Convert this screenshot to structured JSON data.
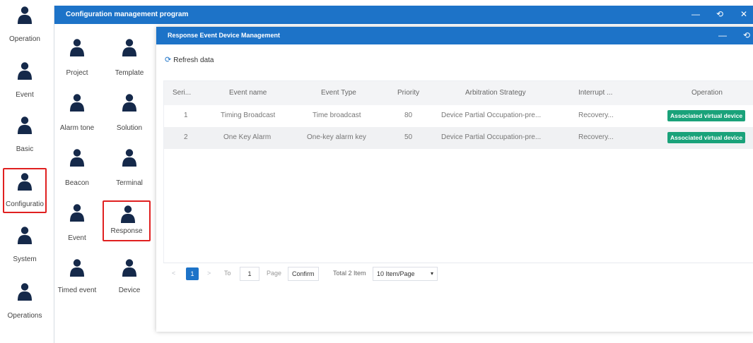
{
  "colors": {
    "titlebar": "#1d73c8",
    "accent": "#1aa27a",
    "selected_border": "#e02020",
    "person_icon": "#15294a"
  },
  "sidebar": {
    "items": [
      {
        "label": "Operation",
        "icon": "user-icon"
      },
      {
        "label": "Event",
        "icon": "user-icon"
      },
      {
        "label": "Basic",
        "icon": "user-icon"
      },
      {
        "label": "Configuratio",
        "icon": "user-icon",
        "selected": true
      },
      {
        "label": "System",
        "icon": "user-icon"
      },
      {
        "label": "Operations",
        "icon": "user-icon"
      }
    ]
  },
  "program": {
    "title": "Configuration management program",
    "controls": {
      "minimize": "—",
      "restore": "⟲",
      "close": "✕"
    },
    "grid": [
      {
        "label": "Project"
      },
      {
        "label": "Template"
      },
      {
        "label": "Alarm tone"
      },
      {
        "label": "Solution"
      },
      {
        "label": "Beacon"
      },
      {
        "label": "Terminal"
      },
      {
        "label": "Event"
      },
      {
        "label": "Response",
        "selected": true
      },
      {
        "label": "Timed event"
      },
      {
        "label": "Device"
      }
    ]
  },
  "dialog": {
    "title": "Response Event Device Management",
    "controls": {
      "minimize": "—",
      "restore": "⟲"
    },
    "refresh_label": "Refresh data",
    "table": {
      "headers": [
        "Seri...",
        "Event name",
        "Event Type",
        "Priority",
        "Arbitration Strategy",
        "Interrupt ...",
        "Operation"
      ],
      "rows": [
        {
          "serial": "1",
          "name": "Timing Broadcast",
          "type": "Time broadcast",
          "priority": "80",
          "strategy": "Device Partial Occupation-pre...",
          "interrupt": "Recovery...",
          "action": "Associated virtual device"
        },
        {
          "serial": "2",
          "name": "One Key Alarm",
          "type": "One-key alarm key",
          "priority": "50",
          "strategy": "Device Partial Occupation-pre...",
          "interrupt": "Recovery...",
          "action": "Associated virtual device"
        }
      ]
    },
    "pager": {
      "prev": "<",
      "current_page": "1",
      "next": ">",
      "to_label": "To",
      "goto_value": "1",
      "page_label": "Page",
      "confirm_label": "Confirm",
      "total_label": "Total 2 Item",
      "page_size": "10 Item/Page"
    }
  }
}
